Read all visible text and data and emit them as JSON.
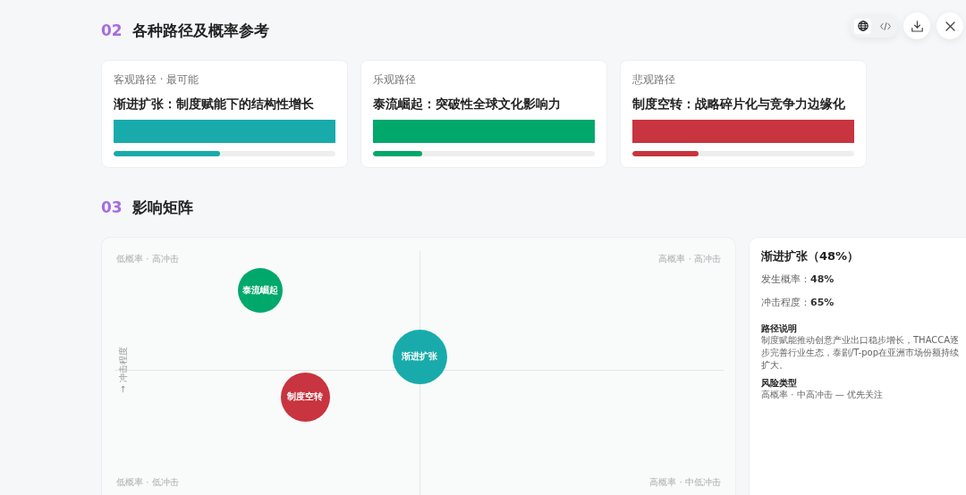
{
  "view_switcher": [
    {
      "kind": "globe",
      "selected": true
    },
    {
      "kind": "code",
      "selected": false
    }
  ],
  "paths_section": {
    "number": "02",
    "title": "各种路径及概率参考",
    "cards": [
      {
        "label": "客观路径 · 最可能",
        "title": "渐进扩张：制度赋能下的结构性增长",
        "color": "#19abab",
        "level": 0.48
      },
      {
        "label": "乐观路径",
        "title": "泰流崛起：突破性全球文化影响力",
        "color": "#00a86b",
        "level": 0.22
      },
      {
        "label": "悲观路径",
        "title": "制度空转：战略碎片化与竞争力边缘化",
        "color": "#c8343f",
        "level": 0.3
      }
    ]
  },
  "matrix_section": {
    "number": "03",
    "title": "影响矩阵",
    "matrix": {
      "quadrant_labels": [
        "低概率 · 高冲击",
        "高概率 · 高冲击",
        "低概率 · 低冲击",
        "高概率 · 中低冲击"
      ],
      "y_axis_label": "→ 冲击程度",
      "bubbles": [
        {
          "label": "泰流崛起",
          "color": "#00a86b"
        },
        {
          "label": "渐进扩张",
          "color": "#19abab"
        },
        {
          "label": "制度空转",
          "color": "#c8343f"
        }
      ]
    },
    "detail": {
      "title": "渐进扩张（48%）",
      "stats": [
        "发生概率：**48%**",
        "冲击程度：**65%**"
      ],
      "blocks": [
        {
          "heading": "路径说明",
          "text": "制度赋能推动创意产业出口稳步增长，THACCA逐步完善行业生态，泰剧/T-pop在亚洲市场份额持续扩大。"
        },
        {
          "heading": "风险类型",
          "text": "高概率 · 中高冲击 — 优先关注"
        }
      ]
    }
  }
}
